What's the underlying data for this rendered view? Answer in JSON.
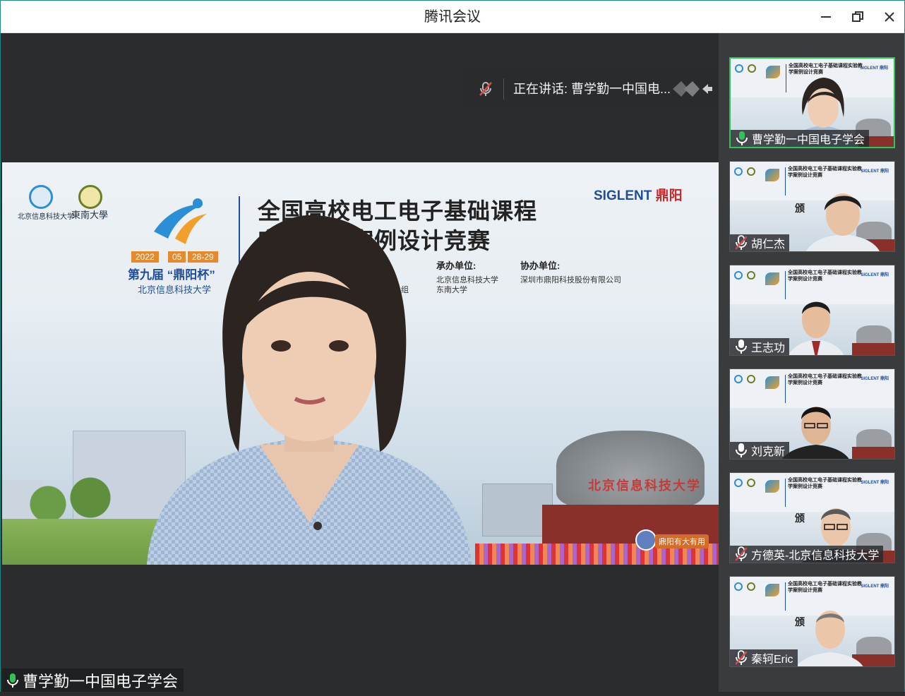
{
  "window": {
    "title": "腾讯会议"
  },
  "speaking_bar": {
    "text": "正在讲话: 曹学勤一中国电..."
  },
  "main_video": {
    "banner": {
      "logo_left_caption": "北京信息科技大学",
      "logo_right_caption": "東南大學",
      "chips": [
        "2022",
        "05",
        "28-29"
      ],
      "event_name": "第九届 “鼎阳杯”",
      "event_university": "北京信息科技大学",
      "title_line1": "全国高校电工电子基础课程",
      "title_line2": "实验教学案例设计竞赛",
      "sponsor_brand": "SIGLENT",
      "sponsor_brand_cn": "鼎阳",
      "organizer_heading": "承办单位:",
      "organizer_values": [
        "北京信息科技大学",
        "东南大学"
      ],
      "co_organizer_heading": "协办单位:",
      "co_organizer_value": "深圳市鼎阳科技股份有限公司",
      "fragment": "组",
      "rock_text": "北京信息科技大学",
      "badge_text": "鼎阳有大有用"
    },
    "name_tag": "曹学勤一中国电子学会"
  },
  "participants": [
    {
      "name": "曹学勤一中国电子学会",
      "mic": "on",
      "active": true
    },
    {
      "name": "胡仁杰",
      "mic": "muted",
      "active": false
    },
    {
      "name": "王志功",
      "mic": "on",
      "active": false
    },
    {
      "name": "刘克新",
      "mic": "on",
      "active": false
    },
    {
      "name": "方德英-北京信息科技大学",
      "mic": "muted",
      "active": false
    },
    {
      "name": "秦轲Eric",
      "mic": "muted",
      "active": false
    }
  ],
  "tile_banner": {
    "title": "全国高校电工电子基础课程实验教学案例设计竞赛",
    "brand": "SIGLENT 鼎阳",
    "fragment": "颁"
  },
  "colors": {
    "accent_green": "#2fc45a",
    "muted_red": "#e04848",
    "background": "#2b2c2e"
  },
  "icons": {
    "mic_on": "microphone-icon",
    "mic_muted": "microphone-muted-icon",
    "minimize": "minimize-icon",
    "restore": "restore-icon",
    "close": "close-icon"
  }
}
